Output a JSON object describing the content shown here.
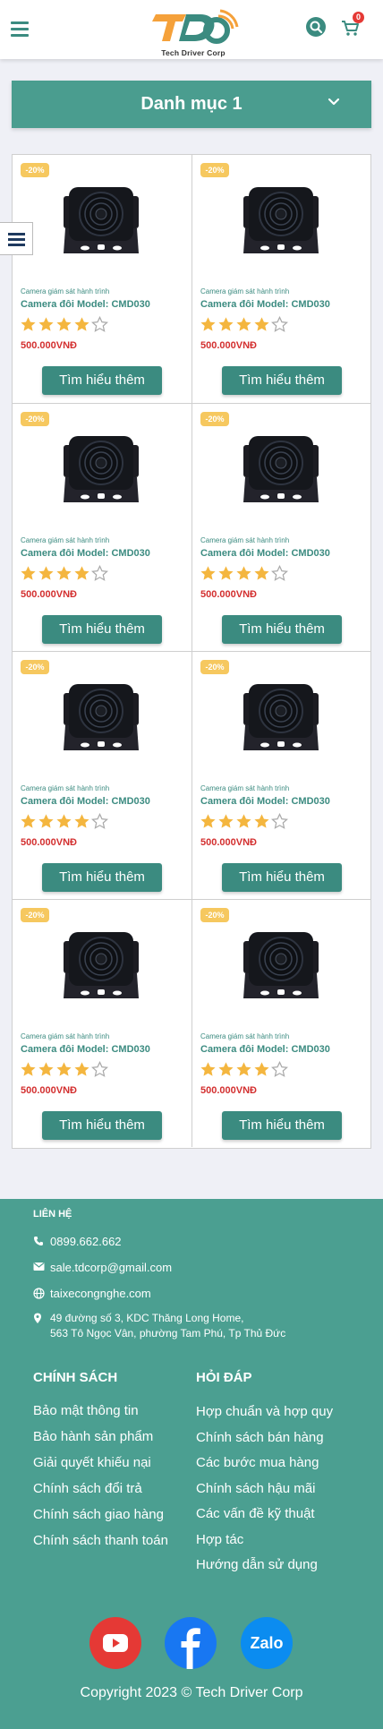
{
  "header": {
    "logo_text": "Tech Driver Corp",
    "cart_count": "0"
  },
  "category": {
    "title": "Danh mục 1"
  },
  "products": [
    {
      "badge": "-20%",
      "category": "Camera giám sát hành trình",
      "name": "Camera đôi Model: CMD030",
      "price": "500.000VNĐ",
      "rating": 4,
      "button": "Tìm hiểu thêm"
    },
    {
      "badge": "-20%",
      "category": "Camera giám sát hành trình",
      "name": "Camera đôi Model: CMD030",
      "price": "500.000VNĐ",
      "rating": 4,
      "button": "Tìm hiểu thêm"
    },
    {
      "badge": "-20%",
      "category": "Camera giám sát hành trình",
      "name": "Camera đôi Model: CMD030",
      "price": "500.000VNĐ",
      "rating": 4,
      "button": "Tìm hiểu thêm"
    },
    {
      "badge": "-20%",
      "category": "Camera giám sát hành trình",
      "name": "Camera đôi Model: CMD030",
      "price": "500.000VNĐ",
      "rating": 4,
      "button": "Tìm hiểu thêm"
    },
    {
      "badge": "-20%",
      "category": "Camera giám sát hành trình",
      "name": "Camera đôi Model: CMD030",
      "price": "500.000VNĐ",
      "rating": 4,
      "button": "Tìm hiểu thêm"
    },
    {
      "badge": "-20%",
      "category": "Camera giám sát hành trình",
      "name": "Camera đôi Model: CMD030",
      "price": "500.000VNĐ",
      "rating": 4,
      "button": "Tìm hiểu thêm"
    },
    {
      "badge": "-20%",
      "category": "Camera giám sát hành trình",
      "name": "Camera đôi Model: CMD030",
      "price": "500.000VNĐ",
      "rating": 4,
      "button": "Tìm hiểu thêm"
    },
    {
      "badge": "-20%",
      "category": "Camera giám sát hành trình",
      "name": "Camera đôi Model: CMD030",
      "price": "500.000VNĐ",
      "rating": 4,
      "button": "Tìm hiểu thêm"
    }
  ],
  "footer": {
    "contact_title": "LIÊN HỆ",
    "phone": "0899.662.662",
    "email": "sale.tdcorp@gmail.com",
    "website": "taixecongnghe.com",
    "address_line1": "49 đường số 3, KDC Thăng Long Home,",
    "address_line2": "563 Tô Ngọc Vân, phường Tam Phú, Tp Thủ Đức",
    "policy_title": "CHÍNH SÁCH",
    "policy_links": [
      "Bảo mật thông tin",
      "Bảo hành sản phẩm",
      "Giải quyết khiếu nại",
      "Chính sách đổi trả",
      "Chính sách giao hàng",
      "Chính sách thanh toán"
    ],
    "faq_title": "HỎI ĐÁP",
    "faq_links": [
      "Hợp chuẩn và hợp quy",
      "Chính sách bán hàng",
      "Các bước mua hàng",
      "Chính sách hậu mãi",
      "Các vấn đề kỹ thuật",
      "Hợp tác",
      "Hướng dẫn sử dụng"
    ],
    "zalo_label": "Zalo",
    "copyright": "Copyright 2023 © Tech Driver Corp"
  },
  "colors": {
    "primary": "#3b8b80",
    "footer_bg": "#4b9f91",
    "badge": "#f6c85f",
    "price": "#d32f2f",
    "star": "#f4b63f"
  },
  "icons": [
    "menu-icon",
    "search-icon",
    "cart-icon",
    "chevron-down-icon",
    "phone-icon",
    "mail-icon",
    "globe-icon",
    "location-icon",
    "youtube-icon",
    "facebook-icon",
    "zalo-icon"
  ]
}
